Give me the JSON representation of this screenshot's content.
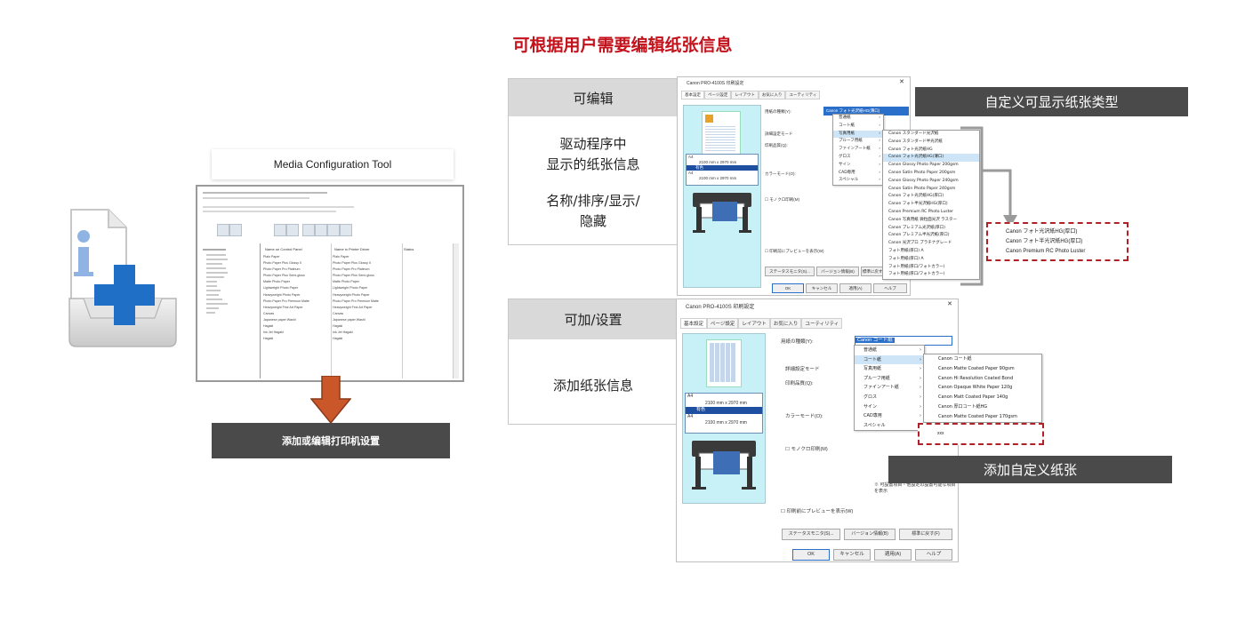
{
  "heading": "可根据用户需要编辑纸张信息",
  "left": {
    "tool_name": "Media Configuration Tool",
    "tool_window": {
      "columns": [
        "Name on Control Panel",
        "Name in Printer Driver",
        "Status"
      ],
      "control_panel_names": [
        "Plain Paper",
        "Photo Paper Plus Glossy II",
        "Photo Paper Pro Platinum",
        "Photo Paper Plus Semi-gloss",
        "Matte Photo Paper",
        "Lightweight Photo Paper",
        "Heavyweight Photo Paper",
        "Photo Paper Pro Premium Matte",
        "Heavyweight Fine Art Paper",
        "Canvas",
        "Japanese paper Washi",
        "Hagaki",
        "Ink Jet Hagaki",
        "Hagaki"
      ],
      "driver_names": [
        "Plain Paper",
        "Photo Paper Plus Glossy II",
        "Photo Paper Pro Platinum",
        "Photo Paper Plus Semi-gloss",
        "Matte Photo Paper",
        "Lightweight Photo Paper",
        "Heavyweight Photo Paper",
        "Photo Paper Pro Premium Matte",
        "Heavyweight Fine Art Paper",
        "Canvas",
        "Japanese paper Washi",
        "Hagaki",
        "Ink Jet Hagaki",
        "Hagaki"
      ]
    },
    "action_label": "添加或编辑打印机设置"
  },
  "panel_top": {
    "header": "可编辑",
    "lines": [
      "驱动程序中",
      "显示的纸张信息"
    ],
    "lines2": [
      "名称/排序/显示/",
      "隐藏"
    ]
  },
  "panel_bottom": {
    "header": "可加/设置",
    "lines": [
      "添加纸张信息"
    ]
  },
  "dialog_top": {
    "title": "Canon PRO-4100S 印刷設定",
    "tabs": [
      "基本設定",
      "ページ設定",
      "レイアウト",
      "お気に入り",
      "ユーティリティ"
    ],
    "media_label": "用紙の種類(Y):",
    "media_value": "Canon フォト光沢紙HG(薄口)",
    "mode_label": "詳細設定モード",
    "quality_label": "印刷品質(Q):",
    "color_label": "カラーモード(O):",
    "mono_label": "モノクロ印刷(M)",
    "preview_label": "印刷前にプレビューを表示(W)",
    "size_text": "2100 mm x 2970 mm",
    "paper_size": "A4",
    "paper_color": "有色",
    "buttons": [
      "ステータスモニタ(S)...",
      "バージョン情報(B)",
      "標準に戻す(F)"
    ],
    "ok": "OK",
    "cancel": "キャンセル",
    "apply": "適用(A)",
    "help": "ヘルプ",
    "menu": [
      "普通紙",
      "コート紙",
      "写真用紙",
      "プルーフ用紙",
      "ファインアート紙",
      "グロス",
      "サイン",
      "CAD専用",
      "スペシャル"
    ],
    "submenu": [
      "Canon スタンダード光沢紙",
      "Canon スタンダード半光沢紙",
      "Canon フォト光沢紙HG",
      "Canon フォト光沢紙HG(薄口)",
      "Canon Glossy Photo Paper 200gsm",
      "Canon Satin Photo Paper 200gsm",
      "Canon Glossy Photo Paper 240gsm",
      "Canon Satin Photo Paper 240gsm",
      "Canon フォト光沢紙HG(厚口)",
      "Canon フォト半光沢紙HG(厚口)",
      "Canon Premium RC Photo Luster",
      "Canon 写真用紙 微粒面光沢 ラスター",
      "Canon プレミアム光沢紙(厚口)",
      "Canon プレミアム半光沢紙(厚口)",
      "Canon 光沢プロ プラチナグレード",
      "フォト用紙(厚口) A",
      "フォト用紙(厚口) A",
      "フォト用紙(厚口/フォトカラー)",
      "フォト用紙(厚口/フォトカラー)"
    ]
  },
  "callout_top": "自定义可显示纸张类型",
  "callout_result": [
    "Canon フォト光沢紙HG(厚口)",
    "Canon フォト半光沢紙HG(厚口)",
    "Canon Premium RC Photo Luster"
  ],
  "dialog_bottom": {
    "title": "Canon PRO-4100S 印刷設定",
    "tabs": [
      "基本設定",
      "ページ設定",
      "レイアウト",
      "お気に入り",
      "ユーティリティ"
    ],
    "media_label": "用紙の種類(Y):",
    "media_value": "Canon コート紙",
    "mode_label": "詳細設定モード",
    "quality_label": "印刷品質(Q):",
    "color_label": "カラーモード(O):",
    "mono_label": "モノクロ印刷(M)",
    "preview_label": "印刷前にプレビューを表示(W)",
    "size_text": "2100 mm x 2970 mm",
    "paper_size": "A4",
    "paper_color": "有色",
    "note": "※ 可設置項目・他設定の設置可能な項目を表示",
    "buttons": [
      "ステータスモニタ(S)...",
      "バージョン情報(B)",
      "標準に戻す(F)"
    ],
    "ok": "OK",
    "cancel": "キャンセル",
    "apply": "適用(A)",
    "help": "ヘルプ",
    "menu": [
      "普通紙",
      "コート紙",
      "写真用紙",
      "プルーフ用紙",
      "ファインアート紙",
      "グロス",
      "サイン",
      "CAD専用",
      "スペシャル"
    ],
    "submenu": [
      "Canon コート紙",
      "Canon Matte Coated Paper 90gsm",
      "Canon Hi Resolution Coated Bond",
      "Canon Opaque White Paper 120g",
      "Canon Matt Coated Paper 140g",
      "Canon 厚口コート紙HG",
      "Canon Matte Coated Paper 170gsm"
    ],
    "new_item": "xxx"
  },
  "callout_bottom": "添加自定义纸张"
}
